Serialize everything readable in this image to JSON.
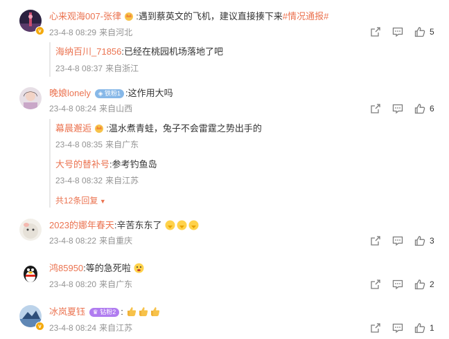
{
  "comments": [
    {
      "user": "心来观海007-张律",
      "text": ":遇到蔡英文的飞机，建议直接揍下来",
      "topic": "#情况通报#",
      "time": "23-4-8 08:29",
      "location": "来自河北",
      "likes": "5",
      "replies": [
        {
          "user": "海纳百川_71856",
          "text": ":已经在桃园机场落地了吧",
          "time": "23-4-8 08:37",
          "location": "来自浙江"
        }
      ]
    },
    {
      "user": "晚娘lonely",
      "badge": "铁粉1",
      "text": ":这作用大吗",
      "time": "23-4-8 08:24",
      "location": "来自山西",
      "likes": "6",
      "replies": [
        {
          "user": "幕晨邂逅",
          "text": ":温水煮青蛙，兔子不会雷霆之势出手的",
          "time": "23-4-8 08:35",
          "location": "来自广东"
        },
        {
          "user": "大号的替补号",
          "text": ":参考钓鱼岛",
          "time": "23-4-8 08:32",
          "location": "来自江苏"
        }
      ],
      "more": "共12条回复"
    },
    {
      "user": "2023的娜年春天",
      "text": ":辛苦东东了",
      "time": "23-4-8 08:22",
      "location": "来自重庆",
      "likes": "3"
    },
    {
      "user": "鸿85950",
      "text": ":等的急死啦",
      "time": "23-4-8 08:20",
      "location": "来自广东",
      "likes": "2"
    },
    {
      "user": "冰岚夏钰",
      "badge": "钻粉2",
      "text": ":",
      "time": "23-4-8 08:24",
      "location": "来自江苏",
      "likes": "1"
    }
  ],
  "icons": {
    "share": "share-icon",
    "comment": "comment-icon",
    "like": "thumbs-up-icon"
  },
  "colors": {
    "username": "#eb7350",
    "meta": "#939393",
    "badge_blue": "#87b8e8",
    "badge_purple": "#b07cf0"
  }
}
